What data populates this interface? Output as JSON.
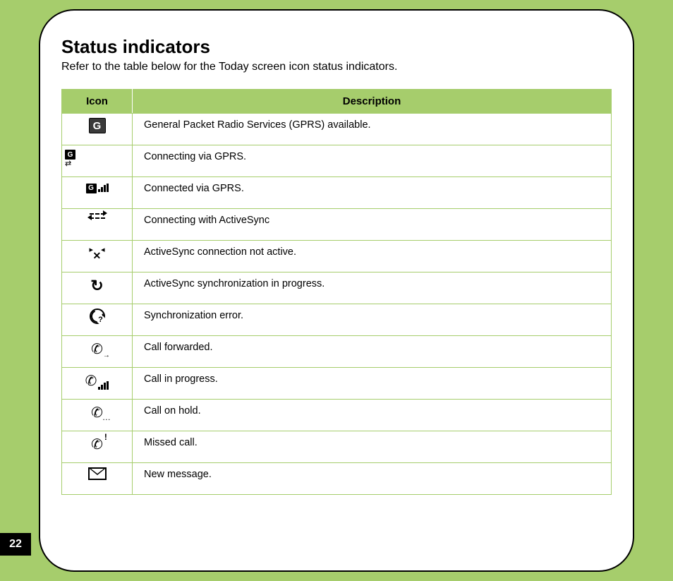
{
  "page_number": "22",
  "title": "Status indicators",
  "subtitle": "Refer to the table below for the Today screen icon status indicators.",
  "table": {
    "headers": {
      "icon": "Icon",
      "description": "Description"
    },
    "rows": [
      {
        "icon_name": "gprs-available-icon",
        "description": "General Packet Radio Services (GPRS) available."
      },
      {
        "icon_name": "gprs-connecting-icon",
        "description": "Connecting via GPRS."
      },
      {
        "icon_name": "gprs-connected-icon",
        "description": "Connected via GPRS."
      },
      {
        "icon_name": "activesync-connecting-icon",
        "description": "Connecting with ActiveSync"
      },
      {
        "icon_name": "activesync-inactive-icon",
        "description": "ActiveSync connection not active."
      },
      {
        "icon_name": "activesync-syncing-icon",
        "description": "ActiveSync synchronization in progress."
      },
      {
        "icon_name": "sync-error-icon",
        "description": "Synchronization error."
      },
      {
        "icon_name": "call-forwarded-icon",
        "description": "Call forwarded."
      },
      {
        "icon_name": "call-in-progress-icon",
        "description": "Call in progress."
      },
      {
        "icon_name": "call-on-hold-icon",
        "description": "Call on hold."
      },
      {
        "icon_name": "missed-call-icon",
        "description": "Missed call."
      },
      {
        "icon_name": "new-message-icon",
        "description": "New message."
      }
    ]
  }
}
